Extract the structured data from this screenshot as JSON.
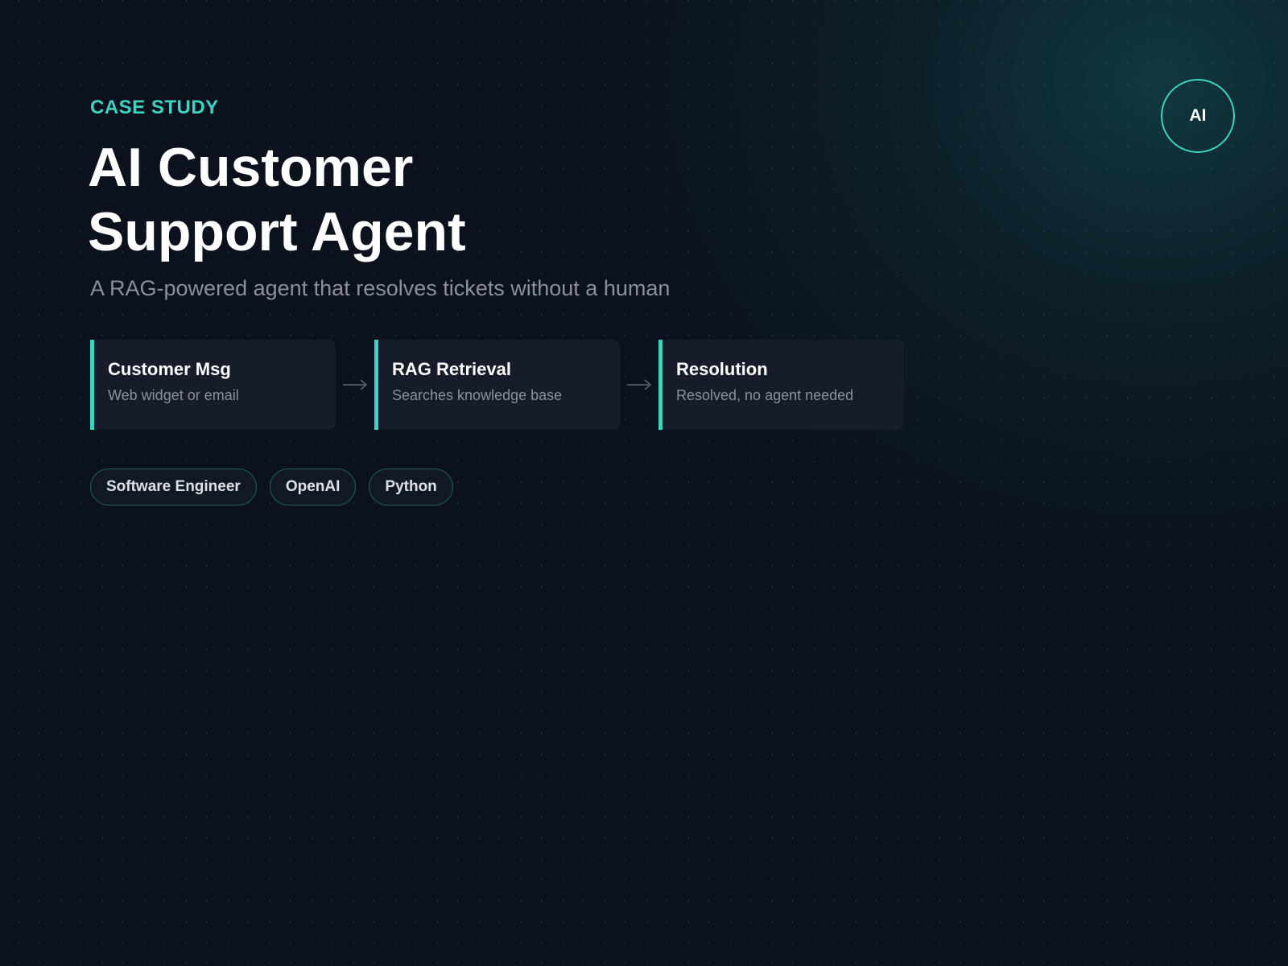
{
  "header": {
    "eyebrow": "CASE STUDY",
    "title_line1": "AI Customer",
    "title_line2": "Support Agent",
    "subtitle": "A RAG-powered agent that resolves tickets without a human"
  },
  "badge": {
    "label": "AI"
  },
  "pipeline": {
    "steps": [
      {
        "title": "Customer Msg",
        "description": "Web widget or email"
      },
      {
        "title": "RAG Retrieval",
        "description": "Searches knowledge base"
      },
      {
        "title": "Resolution",
        "description": "Resolved, no agent needed"
      }
    ],
    "connector_icon": "arrow-right-icon"
  },
  "tags": [
    "Software Engineer",
    "OpenAI",
    "Python"
  ],
  "colors": {
    "accent": "#3ed3c3",
    "background": "#0b111d",
    "card": "#161c29",
    "muted_text": "#8b919c"
  }
}
